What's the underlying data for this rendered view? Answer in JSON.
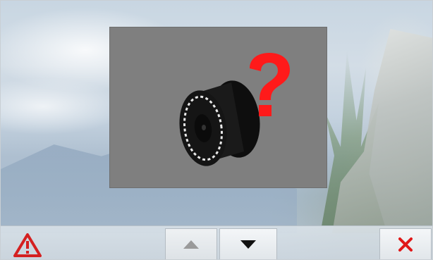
{
  "dialog": {
    "icon": "thread-spool-unknown-icon",
    "question_mark": "?"
  },
  "toolbar": {
    "warning_icon": "warning-triangle-icon",
    "scroll_up_icon": "triangle-up-icon",
    "scroll_down_icon": "triangle-down-icon",
    "close_icon": "close-x-icon"
  },
  "colors": {
    "dialog_background": "#7f7f7f",
    "question_mark": "#ff1a1a",
    "spool": "#111111",
    "warning": "#d42020",
    "close": "#e01818"
  }
}
